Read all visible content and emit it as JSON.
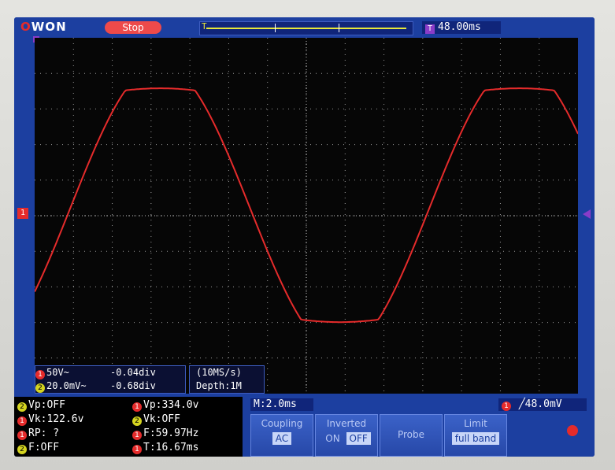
{
  "header": {
    "logo": "OWON",
    "run_state": "Stop",
    "trigger_delay": "48.00ms",
    "trigger_delay_badge": "T"
  },
  "colors": {
    "ch1": "#e52b2b",
    "ch2": "#d4d420",
    "frame": "#1c3fa0",
    "trigger": "#8a3cc8"
  },
  "channel_scale": {
    "ch1_label": "50V~",
    "ch1_offset": "-0.04div",
    "ch2_label": "20.0mV~",
    "ch2_offset": "-0.68div"
  },
  "sampling": {
    "rate": "(10MS/s)",
    "depth": "Depth:1M"
  },
  "measurements": {
    "ch2_vp": "Vp:OFF",
    "ch1_vp": "Vp:334.0v",
    "ch1_vk": "Vk:122.6v",
    "ch2_vk": "Vk:OFF",
    "ch1_rp": "RP:  ?",
    "ch1_f": "F:59.97Hz",
    "ch2_f": "F:OFF",
    "ch1_t": "T:16.67ms"
  },
  "timebase": "M:2.0ms",
  "trigger_level": "48.0mV",
  "trigger_badge": "1",
  "menu": {
    "coupling_title": "Coupling",
    "coupling_value": "AC",
    "inverted_title": "Inverted",
    "inverted_on": "ON",
    "inverted_off": "OFF",
    "probe_title": "Probe",
    "limit_title": "Limit",
    "limit_value": "full band"
  },
  "ch1_marker": "1"
}
